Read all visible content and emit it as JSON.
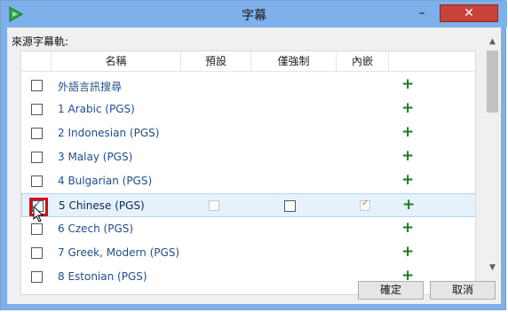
{
  "window": {
    "title": "字幕",
    "minimize_label": "–",
    "close_label": "✕"
  },
  "dialog": {
    "group_label": "來源字幕軌:",
    "columns": [
      "名稱",
      "預設",
      "僅強制",
      "內嵌"
    ],
    "tracks": [
      {
        "label": "外語言訊搜尋",
        "checked": false,
        "selected": false
      },
      {
        "label": "1 Arabic (PGS)",
        "checked": false,
        "selected": false
      },
      {
        "label": "2 Indonesian (PGS)",
        "checked": false,
        "selected": false
      },
      {
        "label": "3 Malay (PGS)",
        "checked": false,
        "selected": false
      },
      {
        "label": "4 Bulgarian (PGS)",
        "checked": false,
        "selected": false
      },
      {
        "label": "5 Chinese (PGS)",
        "checked": true,
        "selected": true
      },
      {
        "label": "6 Czech (PGS)",
        "checked": false,
        "selected": false
      },
      {
        "label": "7 Greek, Modern (PGS)",
        "checked": false,
        "selected": false
      },
      {
        "label": "8 Estonian (PGS)",
        "checked": false,
        "selected": false
      }
    ],
    "add_icon": "+",
    "ok_label": "確定",
    "cancel_label": "取消"
  },
  "colors": {
    "titlebar": "#7eb0ea",
    "close": "#c7433a",
    "highlight": "#e2001a",
    "plus": "#1a7f1a"
  }
}
